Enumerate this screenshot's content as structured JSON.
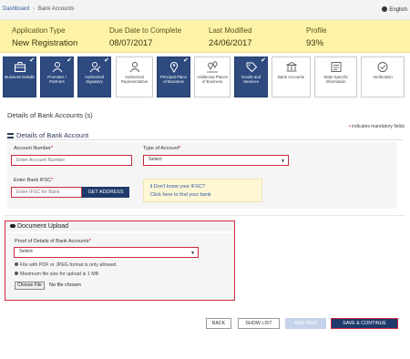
{
  "breadcrumb": {
    "dashboard": "Dashboard",
    "separator": "›",
    "current": "Bank Accounts"
  },
  "language": {
    "label": "English",
    "icon": "globe-icon"
  },
  "summary": {
    "application_type": {
      "label": "Application Type",
      "value": "New Registration"
    },
    "due_date": {
      "label": "Due Date to Complete",
      "value": "08/07/2017"
    },
    "last_modified": {
      "label": "Last Modified",
      "value": "24/06/2017"
    },
    "profile": {
      "label": "Profile",
      "value": "93%"
    }
  },
  "steps": [
    {
      "label": "Business Details",
      "icon": "briefcase-icon",
      "status": "done"
    },
    {
      "label": "Promoter / Partners",
      "icon": "partners-icon",
      "status": "done"
    },
    {
      "label": "Authorized Signatory",
      "icon": "signatory-icon",
      "status": "done"
    },
    {
      "label": "Authorized Representative",
      "icon": "representative-icon",
      "status": "pending"
    },
    {
      "label": "Principal Place of Business",
      "icon": "location-pin-icon",
      "status": "done"
    },
    {
      "label": "Additional Places of Business",
      "icon": "map-pins-icon",
      "status": "pending"
    },
    {
      "label": "Goods and Services",
      "icon": "tag-icon",
      "status": "done"
    },
    {
      "label": "Bank Accounts",
      "icon": "bank-icon",
      "status": "active"
    },
    {
      "label": "State Specific Information",
      "icon": "form-icon",
      "status": "pending"
    },
    {
      "label": "Verification",
      "icon": "check-circle-icon",
      "status": "pending"
    }
  ],
  "section_title": "Details of Bank Accounts (s)",
  "mandatory_note": "indicates mandatory fields",
  "mandatory_star": "•",
  "bank_subsection_title": "Details of Bank Account",
  "form": {
    "account_number": {
      "label": "Account Number",
      "required": "*",
      "placeholder": "Enter Account Number"
    },
    "account_type": {
      "label": "Type of Account",
      "required": "*",
      "selected": "Select"
    },
    "ifsc": {
      "label": "Enter Bank IFSC",
      "required": "*",
      "placeholder": "Enter IFSC for Bank",
      "button": "GET ADDRESS"
    },
    "ifsc_help": {
      "line1": "Don't know your IFSC?",
      "line2": "Click here to find your bank",
      "icon": "info-icon"
    }
  },
  "document_upload": {
    "title": "Document Upload",
    "icon": "cloud-upload-icon",
    "proof_label": "Proof of Details of Bank Accounts",
    "proof_required": "*",
    "proof_selected": "Select",
    "notes": [
      "File with PDF or JPEG format is only allowed.",
      "Maximum file size for upload is 1 MB"
    ],
    "choose_file": "Choose File",
    "no_file": "No file chosen"
  },
  "actions": {
    "back": "BACK",
    "show_list": "SHOW LIST",
    "add_new": "ADD NEW",
    "save_continue": "SAVE & CONTINUE"
  }
}
